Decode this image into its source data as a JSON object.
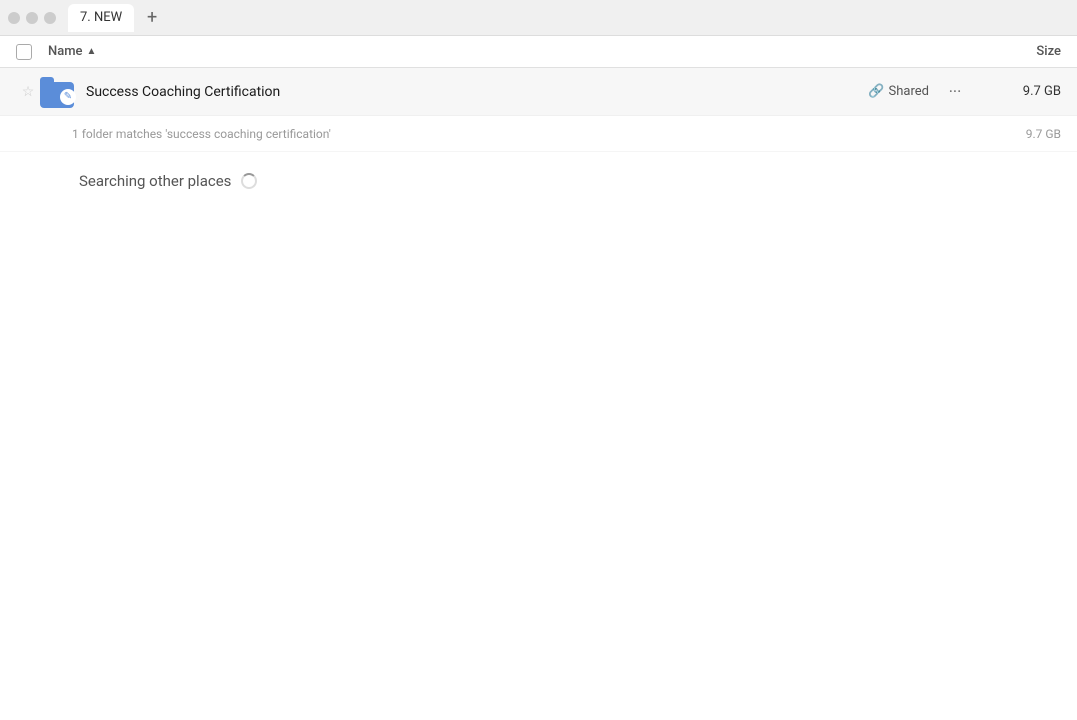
{
  "tabBar": {
    "tabLabel": "7. NEW",
    "addTabLabel": "+"
  },
  "columnHeaders": {
    "nameLabel": "Name",
    "sortIndicator": "▲",
    "sizeLabel": "Size"
  },
  "fileRow": {
    "fileName": "Success Coaching Certification",
    "sharedLabel": "Shared",
    "moreLabel": "···",
    "fileSize": "9.7 GB"
  },
  "matchRow": {
    "matchText": "1 folder matches 'success coaching certification'",
    "matchSize": "9.7 GB"
  },
  "searchingSection": {
    "label": "Searching other places"
  }
}
